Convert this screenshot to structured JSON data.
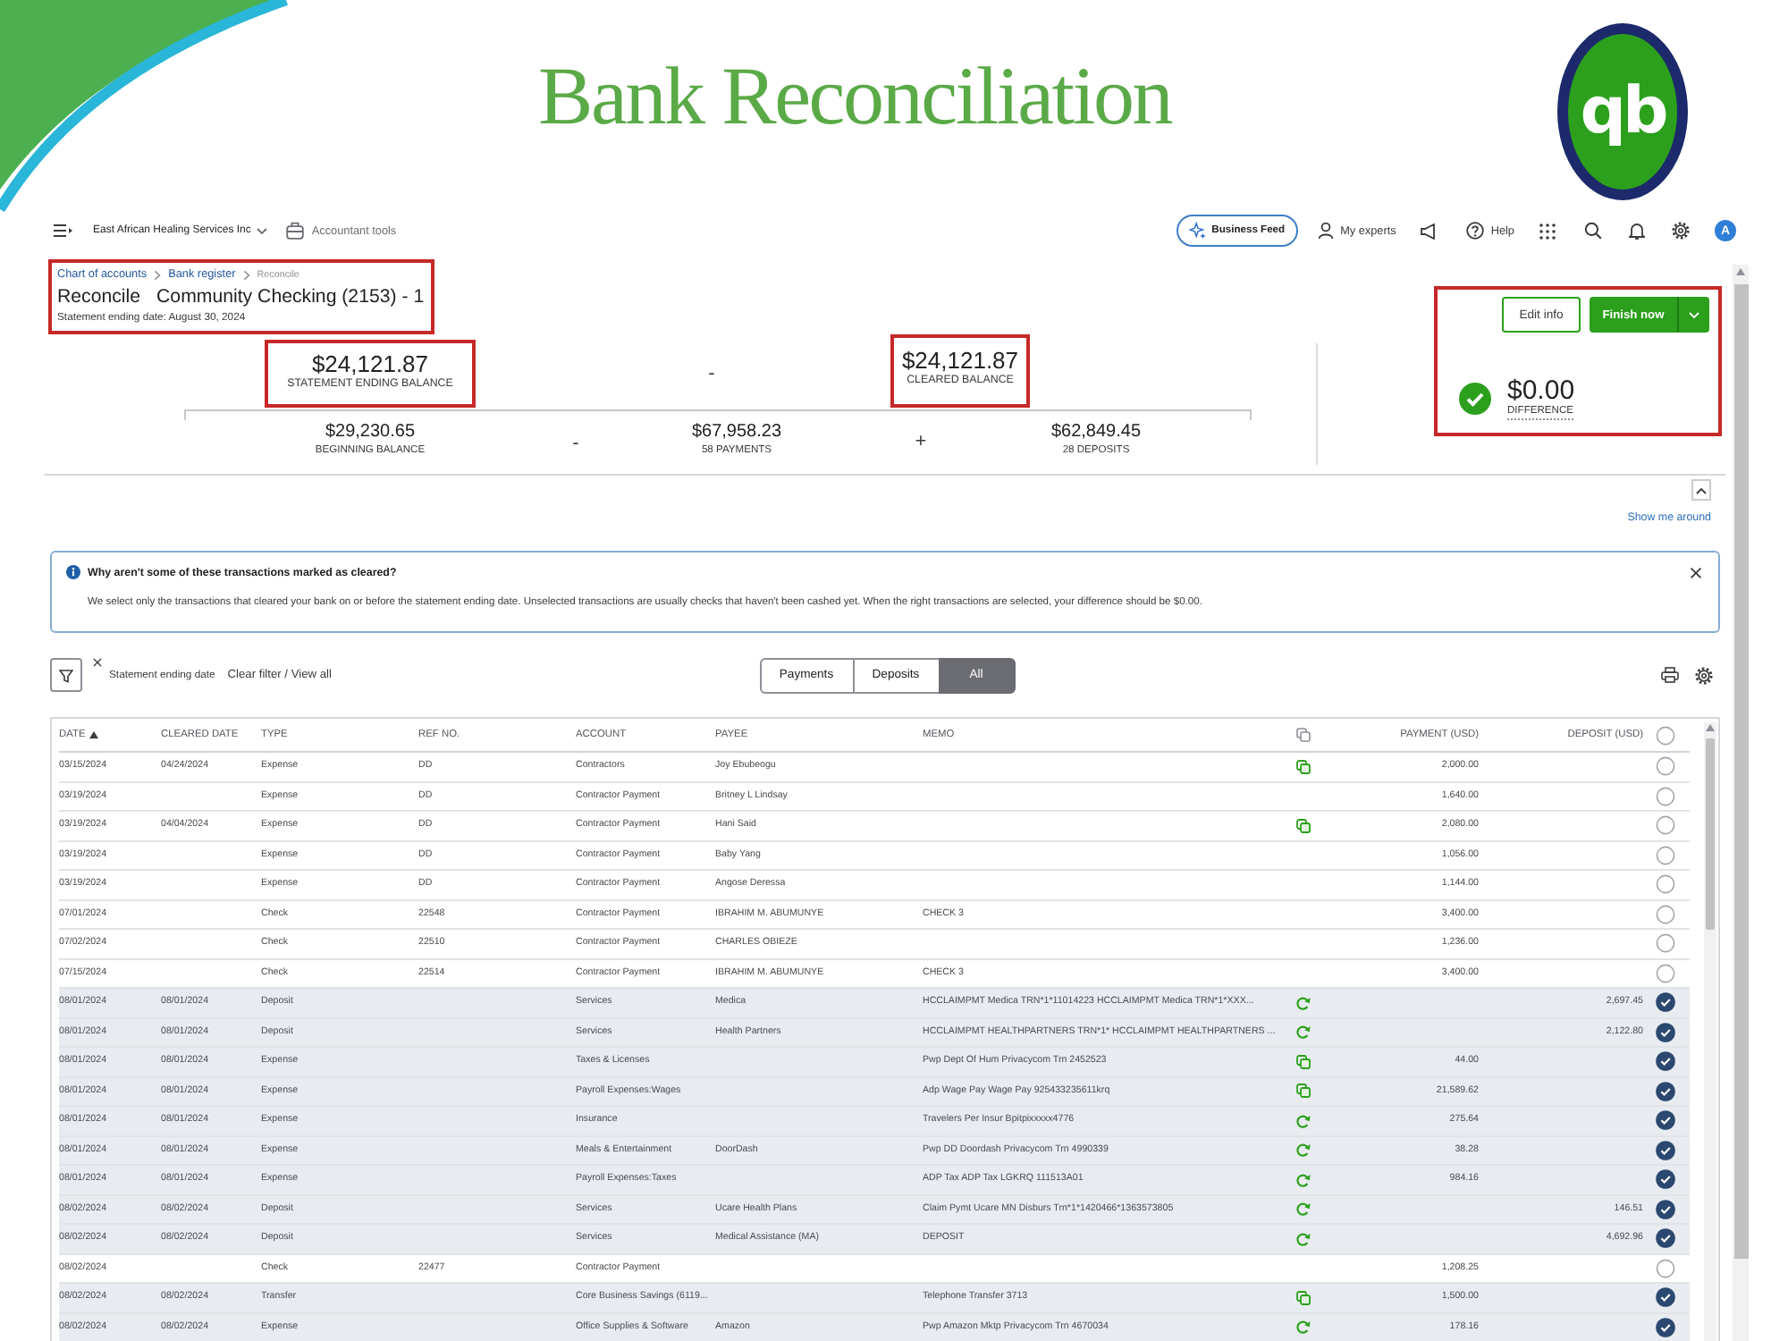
{
  "banner": {
    "title": "Bank Reconciliation",
    "logo": "qb"
  },
  "top_nav": {
    "company": "East African Healing Services Inc",
    "tools": "Accountant tools",
    "feed": "Business Feed",
    "experts": "My experts",
    "help": "Help",
    "avatar": "A"
  },
  "header": {
    "breadcrumbs": [
      {
        "label": "Chart of accounts",
        "kind": "link"
      },
      {
        "label": "Bank register",
        "kind": "link"
      },
      {
        "label": "Reconcile",
        "kind": "current"
      }
    ],
    "title": "Reconcile",
    "account": "Community Checking (2153) - 1",
    "statement_date": "Statement ending date: August 30, 2024"
  },
  "summary": {
    "statement_ending_balance": {
      "amount": "$24,121.87",
      "label": "STATEMENT ENDING BALANCE"
    },
    "top_operator": "-",
    "cleared_balance": {
      "amount": "$24,121.87",
      "label": "CLEARED BALANCE"
    },
    "beginning_balance": {
      "amount": "$29,230.65",
      "label": "BEGINNING BALANCE"
    },
    "operator_1": "-",
    "payments": {
      "amount": "$67,958.23",
      "label": "58 PAYMENTS"
    },
    "operator_2": "+",
    "deposits": {
      "amount": "$62,849.45",
      "label": "28 DEPOSITS"
    }
  },
  "actions": {
    "buttons": [
      {
        "label": "Edit info",
        "kind": "secondary"
      },
      {
        "label": "Finish now",
        "kind": "primary"
      }
    ],
    "difference": {
      "amount": "$0.00",
      "label": "DIFFERENCE",
      "balanced": true
    }
  },
  "show_me_around": "Show me around",
  "info_banner": {
    "title": "Why aren't some of these transactions marked as cleared?",
    "body": "We select only the transactions that cleared your bank on or before the statement ending date. Unselected transactions are usually checks that haven't been cashed yet. When the right transactions are selected, your difference should be $0.00."
  },
  "filter": {
    "label": "Statement ending date",
    "clear_link": "Clear filter / View all",
    "tabs": [
      {
        "label": "Payments",
        "selected": false
      },
      {
        "label": "Deposits",
        "selected": false
      },
      {
        "label": "All",
        "selected": true
      }
    ]
  },
  "table": {
    "columns": [
      {
        "kind": "text",
        "label": "DATE",
        "sorted": true
      },
      {
        "kind": "text",
        "label": "CLEARED DATE",
        "sorted": false
      },
      {
        "kind": "text",
        "label": "TYPE",
        "sorted": false
      },
      {
        "kind": "text",
        "label": "REF NO.",
        "sorted": false
      },
      {
        "kind": "text",
        "label": "ACCOUNT",
        "sorted": false
      },
      {
        "kind": "text",
        "label": "PAYEE",
        "sorted": false
      },
      {
        "kind": "text",
        "label": "MEMO",
        "sorted": false
      },
      {
        "kind": "icon"
      },
      {
        "kind": "text",
        "label": "PAYMENT (USD)",
        "sorted": false
      },
      {
        "kind": "text",
        "label": "DEPOSIT (USD)",
        "sorted": false
      },
      {
        "kind": "check",
        "checked": false
      }
    ],
    "rows": [
      {
        "kind": "copy",
        "date": "03/15/2024",
        "cleared_date": "04/24/2024",
        "type": "Expense",
        "ref_no": "DD",
        "account": "Contractors",
        "payee": "Joy Ebubeogu",
        "payment": "2,000.00",
        "cleared": false
      },
      {
        "kind": "plain",
        "date": "03/19/2024",
        "type": "Expense",
        "ref_no": "DD",
        "account": "Contractor Payment",
        "payee": "Britney L Lindsay",
        "payment": "1,640.00",
        "cleared": false
      },
      {
        "kind": "copy",
        "date": "03/19/2024",
        "cleared_date": "04/04/2024",
        "type": "Expense",
        "ref_no": "DD",
        "account": "Contractor Payment",
        "payee": "Hani Said",
        "payment": "2,080.00",
        "cleared": false
      },
      {
        "kind": "plain",
        "date": "03/19/2024",
        "type": "Expense",
        "ref_no": "DD",
        "account": "Contractor Payment",
        "payee": "Baby Yang",
        "payment": "1,056.00",
        "cleared": false
      },
      {
        "kind": "plain",
        "date": "03/19/2024",
        "type": "Expense",
        "ref_no": "DD",
        "account": "Contractor Payment",
        "payee": "Angose Deressa",
        "payment": "1,144.00",
        "cleared": false
      },
      {
        "kind": "plain",
        "date": "07/01/2024",
        "type": "Check",
        "ref_no": "22548",
        "account": "Contractor Payment",
        "payee": "IBRAHIM M. ABUMUNYE",
        "memo": "CHECK 3",
        "payment": "3,400.00",
        "cleared": false
      },
      {
        "kind": "plain",
        "date": "07/02/2024",
        "type": "Check",
        "ref_no": "22510",
        "account": "Contractor Payment",
        "payee": "CHARLES OBIEZE",
        "payment": "1,236.00",
        "cleared": false
      },
      {
        "kind": "plain",
        "date": "07/15/2024",
        "type": "Check",
        "ref_no": "22514",
        "account": "Contractor Payment",
        "payee": "IBRAHIM M. ABUMUNYE",
        "memo": "CHECK 3",
        "payment": "3,400.00",
        "cleared": false
      },
      {
        "kind": "feed",
        "date": "08/01/2024",
        "cleared_date": "08/01/2024",
        "type": "Deposit",
        "account": "Services",
        "payee": "Medica",
        "memo": "HCCLAIMPMT Medica TRN*1*11014223 HCCLAIMPMT Medica TRN*1*XXX...",
        "deposit": "2,697.45",
        "cleared": true
      },
      {
        "kind": "feed",
        "date": "08/01/2024",
        "cleared_date": "08/01/2024",
        "type": "Deposit",
        "account": "Services",
        "payee": "Health Partners",
        "memo": "HCCLAIMPMT HEALTHPARTNERS TRN*1* HCCLAIMPMT HEALTHPARTNERS ...",
        "deposit": "2,122.80",
        "cleared": true
      },
      {
        "kind": "copy",
        "date": "08/01/2024",
        "cleared_date": "08/01/2024",
        "type": "Expense",
        "account": "Taxes & Licenses",
        "memo": "Pwp Dept Of Hum Privacycom Trn 2452523",
        "payment": "44.00",
        "cleared": true
      },
      {
        "kind": "copy",
        "date": "08/01/2024",
        "cleared_date": "08/01/2024",
        "type": "Expense",
        "account": "Payroll Expenses:Wages",
        "memo": "Adp Wage Pay Wage Pay 925433235611krq",
        "payment": "21,589.62",
        "cleared": true
      },
      {
        "kind": "feed",
        "date": "08/01/2024",
        "cleared_date": "08/01/2024",
        "type": "Expense",
        "account": "Insurance",
        "memo": "Travelers Per Insur Bpitpixxxxx4776",
        "payment": "275.64",
        "cleared": true
      },
      {
        "kind": "feed",
        "date": "08/01/2024",
        "cleared_date": "08/01/2024",
        "type": "Expense",
        "account": "Meals & Entertainment",
        "payee": "DoorDash",
        "memo": "Pwp DD Doordash Privacycom Trn 4990339",
        "payment": "38.28",
        "cleared": true
      },
      {
        "kind": "feed",
        "date": "08/01/2024",
        "cleared_date": "08/01/2024",
        "type": "Expense",
        "account": "Payroll Expenses:Taxes",
        "memo": "ADP Tax ADP Tax LGKRQ 111513A01",
        "payment": "984.16",
        "cleared": true
      },
      {
        "kind": "feed",
        "date": "08/02/2024",
        "cleared_date": "08/02/2024",
        "type": "Deposit",
        "account": "Services",
        "payee": "Ucare Health Plans",
        "memo": "Claim Pymt Ucare MN Disburs Trn*1*1420466*1363573805",
        "deposit": "146.51",
        "cleared": true
      },
      {
        "kind": "feed",
        "date": "08/02/2024",
        "cleared_date": "08/02/2024",
        "type": "Deposit",
        "account": "Services",
        "payee": "Medical Assistance (MA)",
        "memo": "DEPOSIT",
        "deposit": "4,692.96",
        "cleared": true
      },
      {
        "kind": "plain",
        "date": "08/02/2024",
        "type": "Check",
        "ref_no": "22477",
        "account": "Contractor Payment",
        "payment": "1,208.25",
        "cleared": false
      },
      {
        "kind": "copy",
        "date": "08/02/2024",
        "cleared_date": "08/02/2024",
        "type": "Transfer",
        "account": "Core Business Savings (6119...",
        "memo": "Telephone Transfer 3713",
        "payment": "1,500.00",
        "cleared": true
      },
      {
        "kind": "feed",
        "date": "08/02/2024",
        "cleared_date": "08/02/2024",
        "type": "Expense",
        "account": "Office Supplies & Software",
        "payee": "Amazon",
        "memo": "Pwp Amazon Mktp Privacycom Trn 4670034",
        "payment": "178.16",
        "cleared": true
      }
    ]
  }
}
